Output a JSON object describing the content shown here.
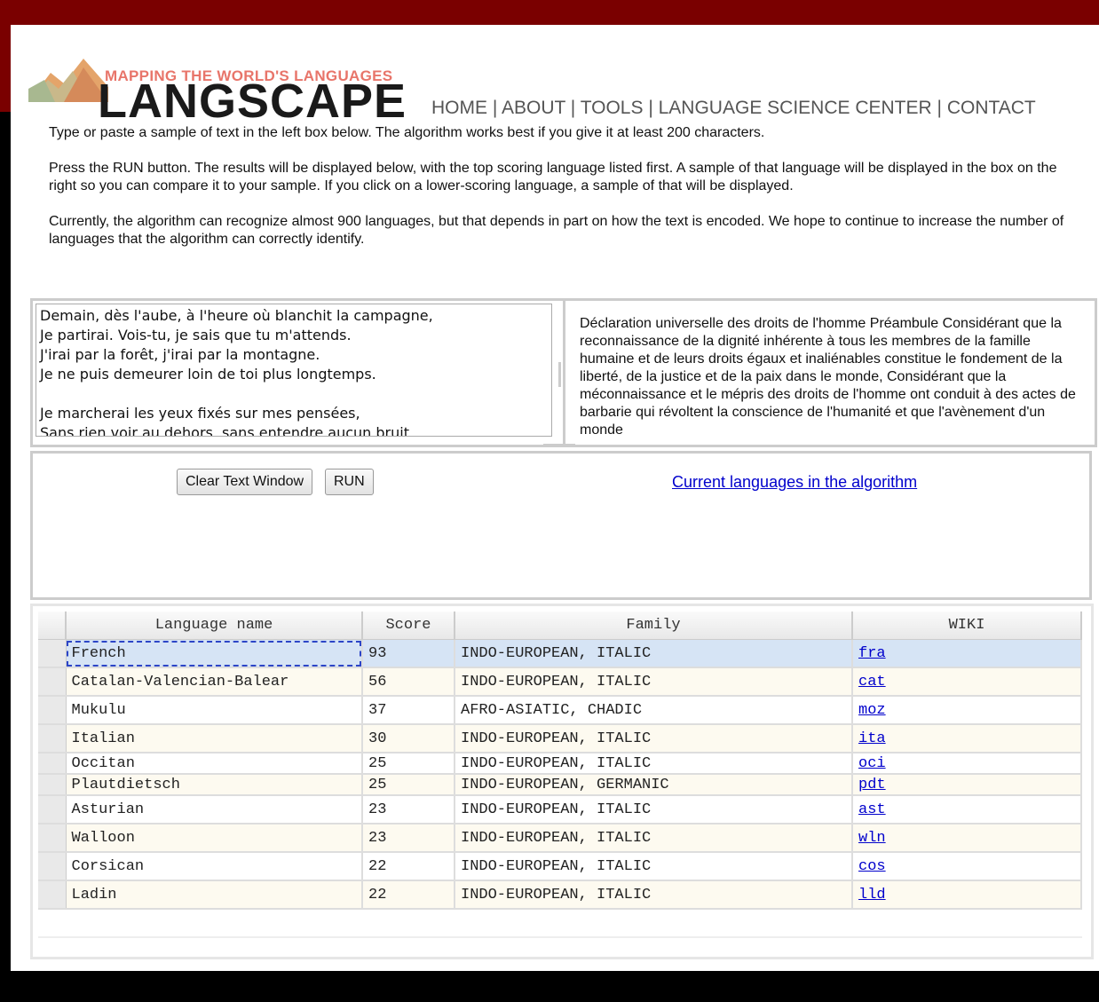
{
  "header": {
    "logo_tagline": "MAPPING THE WORLD'S LANGUAGES",
    "logo_title": "LANGSCAPE",
    "nav": [
      "HOME",
      "ABOUT",
      "TOOLS",
      "LANGUAGE SCIENCE CENTER",
      "CONTACT"
    ]
  },
  "intro": {
    "p1": "Type or paste a sample of text in the left box below. The algorithm works best if you give it at least 200 characters.",
    "p2": "Press the RUN button. The results will be displayed below, with the top scoring language listed first. A sample of that language will be displayed in the box on the right so you can compare it to your sample. If you click on a lower-scoring language, a sample of that will be displayed.",
    "p3": "Currently, the algorithm can recognize almost 900 languages, but that depends in part on how the text is encoded. We hope to continue to increase the number of languages that the algorithm can correctly identify."
  },
  "input": {
    "value": "Demain, dès l'aube, à l'heure où blanchit la campagne,\nJe partirai. Vois-tu, je sais que tu m'attends.\nJ'irai par la forêt, j'irai par la montagne.\nJe ne puis demeurer loin de toi plus longtemps.\n\nJe marcherai les yeux fixés sur mes pensées,\nSans rien voir au dehors, sans entendre aucun bruit,"
  },
  "sample": {
    "text": "Déclaration universelle des droits de l'homme Préambule Considérant que la reconnaissance de la dignité inhérente à tous les membres de la famille humaine et de leurs droits égaux et inaliénables constitue le fondement de la liberté, de la justice et de la paix dans le monde, Considérant que la méconnaissance et le mépris des droits de l'homme ont conduit à des actes de barbarie qui révoltent la conscience de l'humanité et que l'avènement d'un monde"
  },
  "controls": {
    "clear_label": "Clear Text Window",
    "run_label": "RUN",
    "languages_link": "Current languages in the algorithm"
  },
  "results": {
    "columns": [
      "Language name",
      "Score",
      "Family",
      "WIKI"
    ],
    "rows": [
      {
        "name": "French",
        "score": "93",
        "family": "INDO-EUROPEAN, ITALIC",
        "wiki": "fra"
      },
      {
        "name": "Catalan-Valencian-Balear",
        "score": "56",
        "family": "INDO-EUROPEAN, ITALIC",
        "wiki": "cat"
      },
      {
        "name": "Mukulu",
        "score": "37",
        "family": "AFRO-ASIATIC, CHADIC",
        "wiki": "moz"
      },
      {
        "name": "Italian",
        "score": "30",
        "family": "INDO-EUROPEAN, ITALIC",
        "wiki": "ita"
      },
      {
        "name": "Occitan",
        "score": "25",
        "family": "INDO-EUROPEAN, ITALIC",
        "wiki": "oci"
      },
      {
        "name": "Plautdietsch",
        "score": "25",
        "family": "INDO-EUROPEAN, GERMANIC",
        "wiki": "pdt"
      },
      {
        "name": "Asturian",
        "score": "23",
        "family": "INDO-EUROPEAN, ITALIC",
        "wiki": "ast"
      },
      {
        "name": "Walloon",
        "score": "23",
        "family": "INDO-EUROPEAN, ITALIC",
        "wiki": "wln"
      },
      {
        "name": "Corsican",
        "score": "22",
        "family": "INDO-EUROPEAN, ITALIC",
        "wiki": "cos"
      },
      {
        "name": "Ladin",
        "score": "22",
        "family": "INDO-EUROPEAN, ITALIC",
        "wiki": "lld"
      }
    ]
  },
  "colors": {
    "brand_dark_red": "#7a0000",
    "logo_accent": "#e8756a",
    "link": "#0000cc",
    "selected_row": "#d6e4f5"
  }
}
